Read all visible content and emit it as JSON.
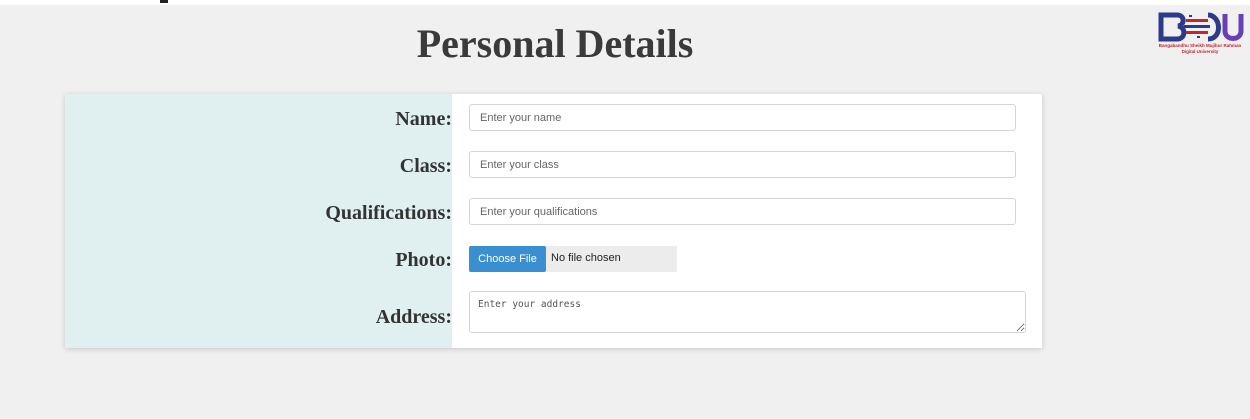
{
  "page": {
    "title": "Personal Details"
  },
  "logo": {
    "caption": "Bangabandhu Sheikh Mujibur Rahman Digital University"
  },
  "form": {
    "name": {
      "label": "Name:",
      "placeholder": "Enter your name"
    },
    "class": {
      "label": "Class:",
      "placeholder": "Enter your class"
    },
    "qualifications": {
      "label": "Qualifications:",
      "placeholder": "Enter your qualifications"
    },
    "photo": {
      "label": "Photo:",
      "button": "Choose File",
      "status": "No file chosen"
    },
    "address": {
      "label": "Address:",
      "placeholder": "Enter your address"
    }
  },
  "colors": {
    "accent": "#3a8fd0",
    "label_panel": "#e0f0f1",
    "logo_blue": "#2d3a8c",
    "logo_red": "#c1272d"
  }
}
